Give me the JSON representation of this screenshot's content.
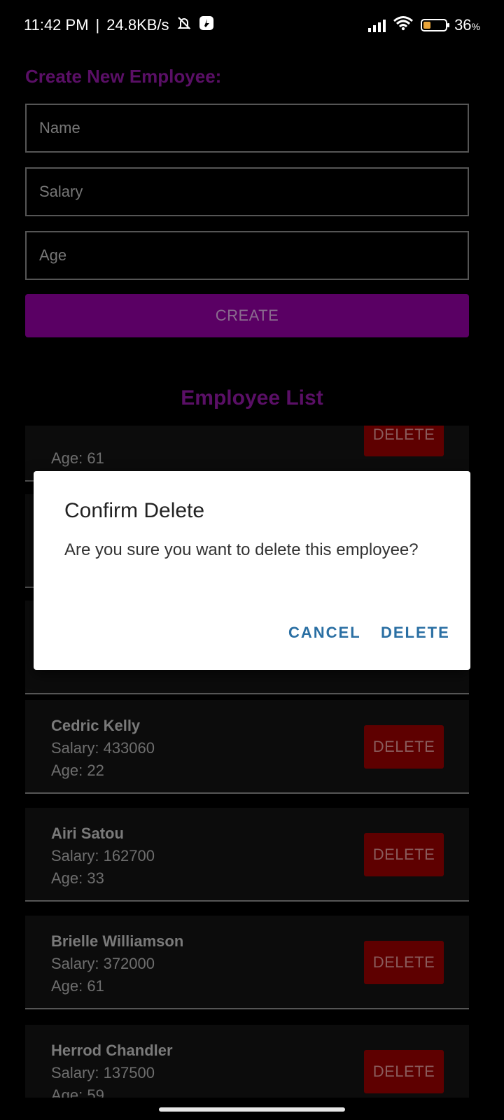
{
  "status_bar": {
    "time": "11:42 PM",
    "network_speed": "24.8KB/s",
    "battery_percent": "36",
    "battery_unit": "%",
    "icons": [
      "bell-muted-icon",
      "app-notification-icon",
      "signal-icon",
      "wifi-icon",
      "battery-icon"
    ]
  },
  "form": {
    "title": "Create New Employee:",
    "name_placeholder": "Name",
    "salary_placeholder": "Salary",
    "age_placeholder": "Age",
    "create_label": "CREATE"
  },
  "list": {
    "title": "Employee List",
    "delete_label": "DELETE",
    "items": [
      {
        "name": "",
        "salary": "",
        "age": "Age: 61"
      },
      {
        "name": "",
        "salary": "",
        "age": ""
      },
      {
        "name": "",
        "salary": "",
        "age": ""
      },
      {
        "name": "Cedric Kelly",
        "salary": "Salary: 433060",
        "age": "Age: 22"
      },
      {
        "name": "Airi Satou",
        "salary": "Salary: 162700",
        "age": "Age: 33"
      },
      {
        "name": "Brielle Williamson",
        "salary": "Salary: 372000",
        "age": "Age: 61"
      },
      {
        "name": "Herrod Chandler",
        "salary": "Salary: 137500",
        "age": "Age: 59"
      }
    ]
  },
  "dialog": {
    "title": "Confirm Delete",
    "message": "Are you sure you want to delete this employee?",
    "cancel_label": "CANCEL",
    "delete_label": "DELETE"
  },
  "colors": {
    "accent_purple": "#5a0f66",
    "button_purple": "#5a0064",
    "delete_red": "#5e0000",
    "dialog_button_blue": "#2a6fa3"
  }
}
